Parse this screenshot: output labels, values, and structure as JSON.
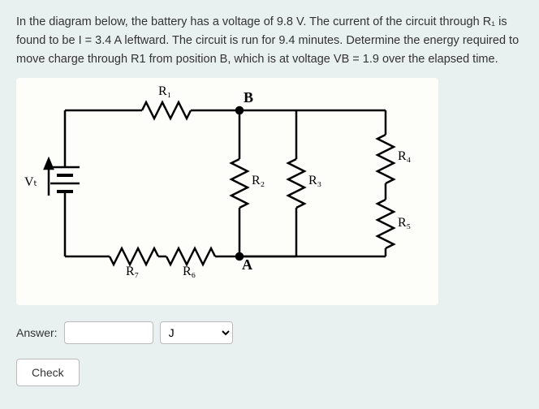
{
  "problem": {
    "text": "In the diagram below, the battery has a voltage of 9.8 V.  The current of the circuit through R₁ is found to be I = 3.4 A leftward.  The circuit is run for 9.4 minutes.  Determine the energy required to move charge through R1 from position B, which is at voltage VB = 1.9 over the elapsed time."
  },
  "diagram": {
    "battery_label": "Vₜ",
    "resistors": {
      "R1": "R₁",
      "R2": "R₂",
      "R3": "R₃",
      "R4": "R₄",
      "R5": "R₅",
      "R6": "R₆",
      "R7": "R₇"
    },
    "nodes": {
      "A": "A",
      "B": "B"
    }
  },
  "answer": {
    "label": "Answer:",
    "value": "",
    "unit_selected": "J"
  },
  "buttons": {
    "check": "Check"
  }
}
